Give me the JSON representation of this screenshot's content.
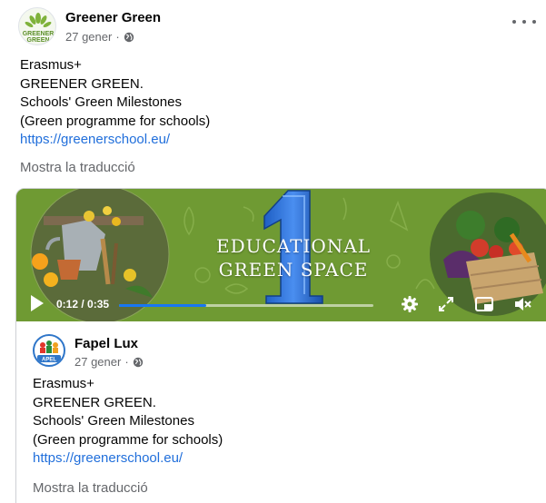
{
  "post": {
    "author": "Greener Green",
    "date": "27 gener",
    "avatar_text": [
      "GREENER",
      "GREEN"
    ],
    "lines": [
      "Erasmus+",
      "GREENER GREEN.",
      "Schools' Green Milestones",
      "(Green programme for schools)"
    ],
    "link": "https://greenerschool.eu/",
    "translate_label": "Mostra la traducció"
  },
  "video": {
    "title_line1": "EDUCATIONAL",
    "title_line2": "GREEN SPACE",
    "big_number": "1",
    "time": "0:12 / 0:35",
    "progress": 0.343,
    "bg_color": "#6f9a33",
    "accent_color": "#1877f2"
  },
  "shared": {
    "author": "Fapel Lux",
    "date": "27 gener",
    "avatar_text": "APEL",
    "lines": [
      "Erasmus+",
      "GREENER GREEN.",
      "Schools' Green Milestones",
      "(Green programme for schools)"
    ],
    "link": "https://greenerschool.eu/",
    "translate_label": "Mostra la traducció"
  },
  "icons": {
    "privacy": "globe-icon",
    "menu": "more-options-icon",
    "play": "play-icon",
    "settings": "gear-icon",
    "fullscreen": "fullscreen-icon",
    "pip": "picture-in-picture-icon",
    "volume": "muted-speaker-icon"
  }
}
